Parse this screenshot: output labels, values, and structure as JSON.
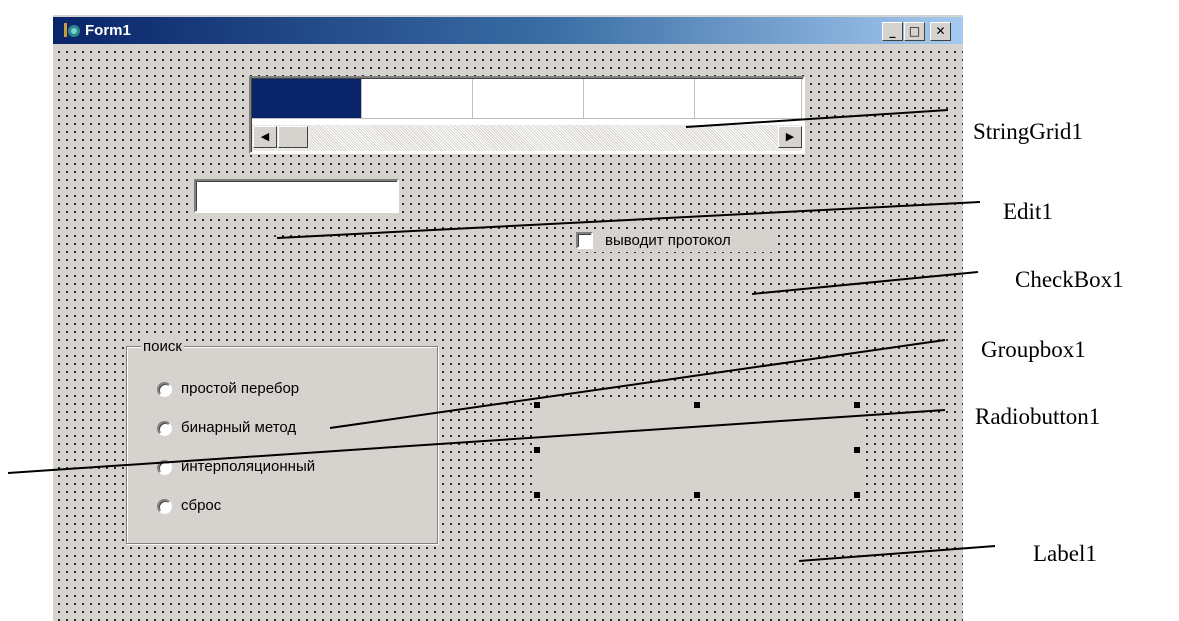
{
  "window": {
    "title": "Form1",
    "title_buttons": {
      "minimize": "_",
      "maximize": "□",
      "close": "✕"
    }
  },
  "string_grid": {
    "columns": 5,
    "fixed_cell_color": "#0a246a",
    "scroll_left": "◀",
    "scroll_right": "▶"
  },
  "edit": {
    "value": ""
  },
  "checkbox": {
    "label": "выводит протокол",
    "checked": false
  },
  "groupbox": {
    "caption": "поиск",
    "radios": [
      {
        "label": "простой перебор",
        "checked": false
      },
      {
        "label": "бинарный метод",
        "checked": false
      },
      {
        "label": "интерполяционный",
        "checked": false
      },
      {
        "label": "сброс",
        "checked": false
      }
    ]
  },
  "callouts": {
    "string_grid": "StringGrid1",
    "edit": "Edit1",
    "checkbox": "CheckBox1",
    "groupbox": "Groupbox1",
    "radiobutton": "Radiobutton1",
    "label": "Label1"
  },
  "colors": {
    "form_bg": "#d6d3ce",
    "title_start": "#0a246a",
    "title_end": "#a6caf0"
  }
}
